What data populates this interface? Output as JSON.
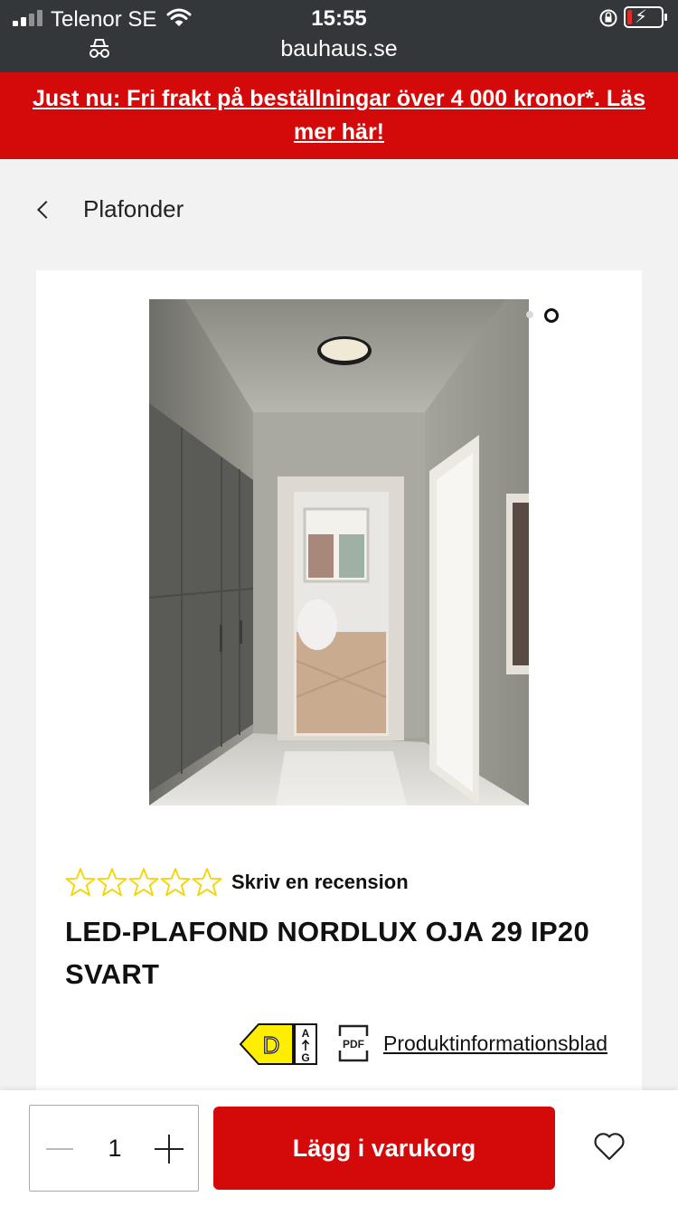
{
  "status_bar": {
    "carrier": "Telenor SE",
    "time": "15:55",
    "url": "bauhaus.se"
  },
  "promo": {
    "text": "Just nu: Fri frakt på beställningar över 4 000 kronor*. Läs mer här!"
  },
  "breadcrumb": {
    "back_label": "Plafonder"
  },
  "product": {
    "gallery_dots": 2,
    "gallery_active_index": 2,
    "rating_stars_filled": 0,
    "rating_stars_total": 5,
    "review_link": "Skriv en recension",
    "title": "LED-PLAFOND NORDLUX OJA 29 IP20 SVART",
    "energy_class": "D",
    "energy_scale_top": "A",
    "energy_scale_bottom": "G",
    "pdf_icon_label": "PDF",
    "info_sheet_link": "Produktinformationsblad"
  },
  "purchase": {
    "quantity": "1",
    "add_to_cart_label": "Lägg i varukorg"
  },
  "colors": {
    "brand_red": "#d40a0a",
    "status_bar_bg": "#34373a",
    "energy_yellow": "#ffee00",
    "star_outline": "#f5d400"
  },
  "icons": {
    "back": "chevron-left-icon",
    "wishlist": "heart-icon",
    "incognito": "incognito-icon",
    "document": "pdf-icon"
  }
}
